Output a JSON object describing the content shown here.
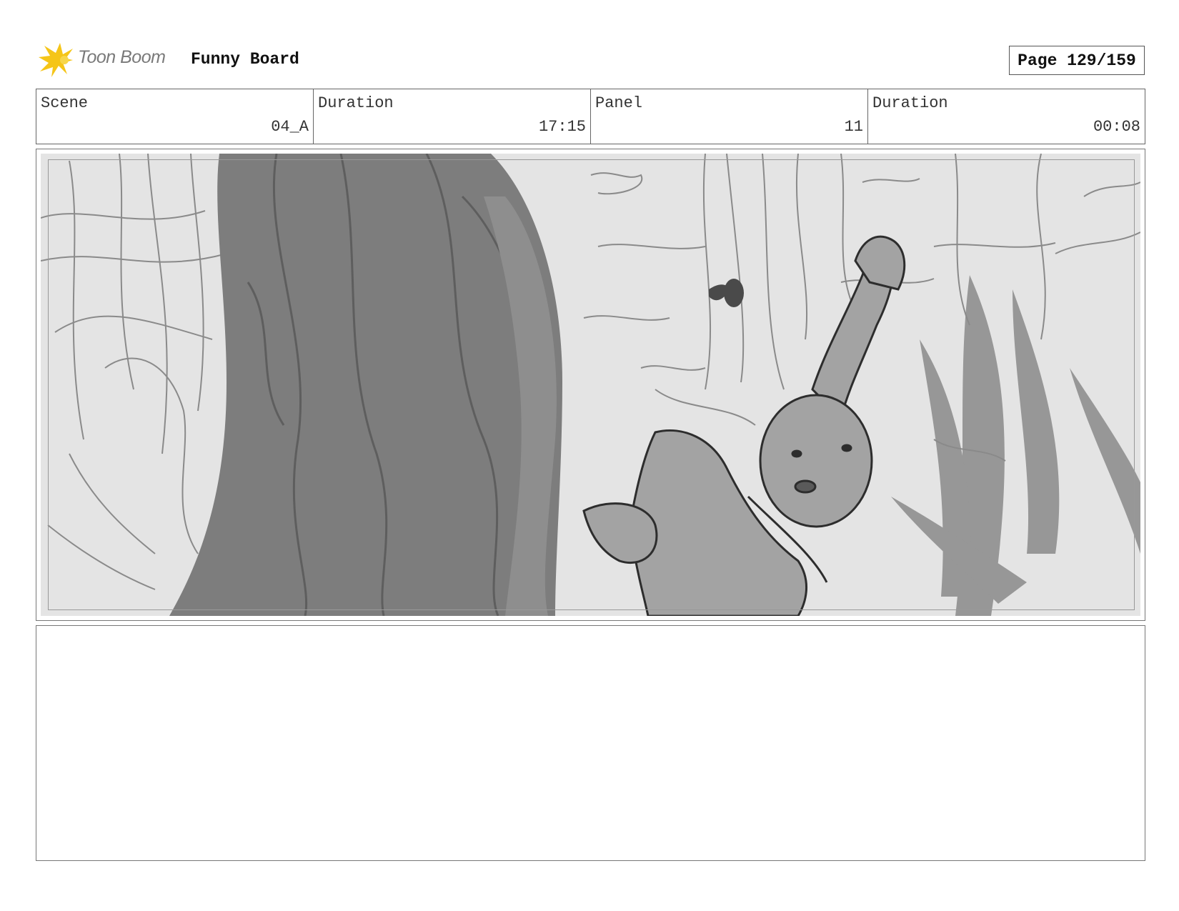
{
  "header": {
    "logo_text": "Toon Boom",
    "board_title": "Funny Board",
    "page": "Page 129/159"
  },
  "info": [
    {
      "label": "Scene",
      "value": "04_A"
    },
    {
      "label": "Duration",
      "value": "17:15"
    },
    {
      "label": "Panel",
      "value": "11"
    },
    {
      "label": "Duration",
      "value": "00:08"
    }
  ],
  "panel": {
    "description": ""
  },
  "colors": {
    "logo_accent": "#f5c518",
    "sketch_bg": "#e4e4e4",
    "tree_fill": "#7d7d7d",
    "character_fill": "#a3a3a3"
  },
  "icons": [
    "toon-boom-star-logo-icon"
  ]
}
